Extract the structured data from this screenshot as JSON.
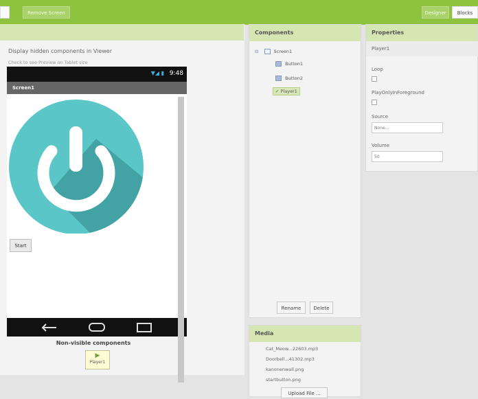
{
  "toolbar": {
    "left_button": "",
    "remove_screen": "Remove Screen",
    "designer": "Designer",
    "blocks": "Blocks"
  },
  "viewer": {
    "display_hidden": "Display hidden components in Viewer",
    "check_preview": "Check to see Preview on Tablet size",
    "status_time": "9:48",
    "screen_title": "Screen1",
    "start_button": "Start",
    "nonvisible_label": "Non-visible components",
    "nonvisible_item": "Player1",
    "icons": {
      "power": "power-icon",
      "back": "back-nav-icon",
      "home": "home-nav-icon",
      "recent": "recent-apps-icon"
    }
  },
  "components": {
    "title": "Components",
    "tree": {
      "root": "Screen1",
      "children": [
        "Button1",
        "Button2",
        "Player1"
      ]
    },
    "rename": "Rename",
    "delete": "Delete"
  },
  "media": {
    "title": "Media",
    "files": [
      "Cat_Meow...22603.mp3",
      "Doorbell...41302.mp3",
      "kanonenwall.png",
      "startbutton.png"
    ],
    "upload": "Upload File ..."
  },
  "properties": {
    "title": "Properties",
    "component": "Player1",
    "loop_label": "Loop",
    "playonly_label": "PlayOnlyInForeground",
    "source_label": "Source",
    "source_value": "None...",
    "volume_label": "Volume",
    "volume_value": "50"
  },
  "colors": {
    "accent": "#8ec33f",
    "header": "#d5e6b3",
    "power_bg": "#5bc6c8",
    "power_fg": "#ffffff",
    "power_shadow": "#3e9b9e"
  }
}
